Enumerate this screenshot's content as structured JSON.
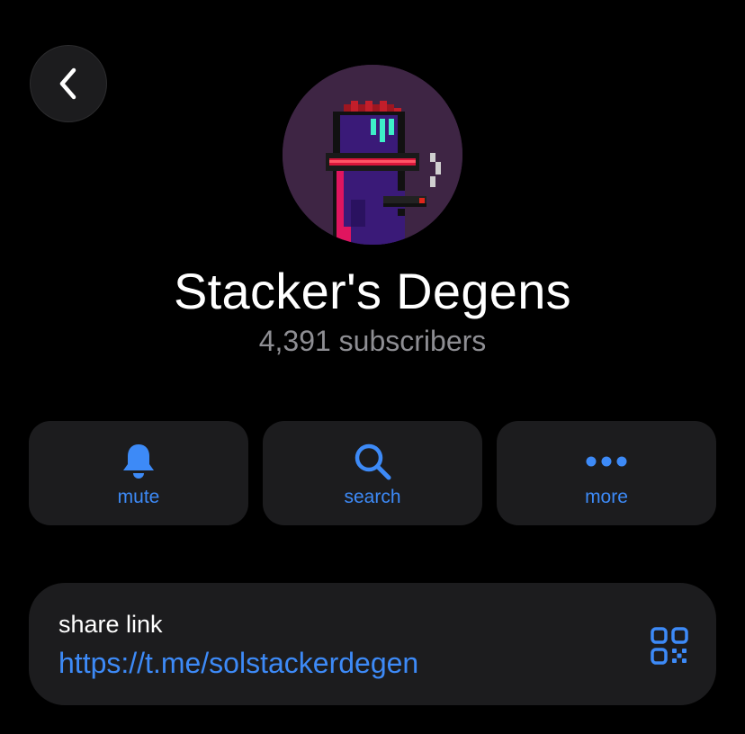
{
  "header": {
    "back_icon": "chevron-left-icon"
  },
  "channel": {
    "name": "Stacker's Degens",
    "subscribers": "4,391 subscribers",
    "avatar_description": "pixel-art-purple-creature-avatar"
  },
  "actions": [
    {
      "label": "mute",
      "icon": "bell-icon"
    },
    {
      "label": "search",
      "icon": "search-icon"
    },
    {
      "label": "more",
      "icon": "more-dots-icon"
    }
  ],
  "share": {
    "label": "share link",
    "url": "https://t.me/solstackerdegen",
    "qr_icon": "qr-code-icon"
  },
  "colors": {
    "background": "#000000",
    "card": "#1c1c1e",
    "accent": "#3d8af7",
    "secondary_text": "#8e8e93"
  }
}
